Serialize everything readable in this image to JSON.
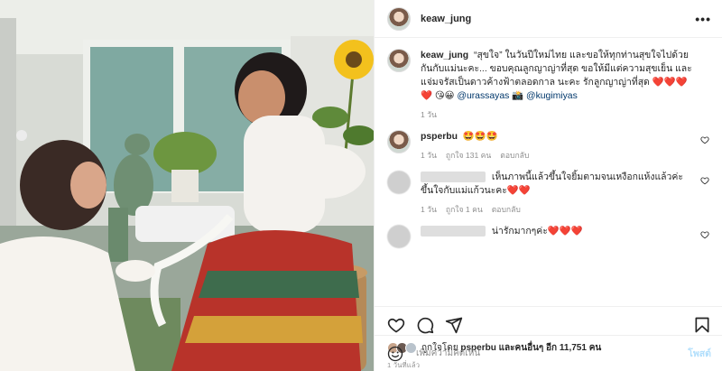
{
  "post": {
    "username": "keaw_jung",
    "more_label": "•••"
  },
  "caption": {
    "username": "keaw_jung",
    "text": "“สุขใจ” ในวันปีใหม่ไทย และขอให้ทุกท่านสุขใจไปด้วยกันกับแม่นะคะ... ขอบคุณลูกญาญ่าที่สุด ขอให้มีแต่ความสุขเย็น และแจ่มจรัสเป็นดาวค้างฟ้าตลอดกาล นะคะ รักลูกญาญ่าที่สุด ❤️❤️❤️❤️ 😘😀",
    "mention1": "@urassayas",
    "camera": "📸",
    "mention2": "@kugimiyas",
    "time": "1 วัน"
  },
  "comments": [
    {
      "username": "psperbu",
      "text": "🤩🤩🤩",
      "time": "1 วัน",
      "likes": "ถูกใจ 131 คน",
      "reply": "ตอบกลับ"
    },
    {
      "username": "",
      "text": "เห็นภาพนี้แล้วขึ้นใจยิ้มตามจนเหงือกแห้งแล้วค่ะขึ้นใจกับแม่แก้วนะคะ❤️❤️",
      "time": "1 วัน",
      "likes": "ถูกใจ 1 คน",
      "reply": "ตอบกลับ"
    },
    {
      "username": "",
      "text": "น่ารักมากๆค่ะ❤️❤️❤️",
      "time": "",
      "likes": "",
      "reply": ""
    }
  ],
  "liked_by": {
    "prefix": "ถูกใจโดย",
    "user": "psperbu",
    "suffix": "และคนอื่นๆ อีก 11,751 คน"
  },
  "posted_ago": "1 วันที่แล้ว",
  "add_comment": {
    "placeholder": "เพิ่มความคิดเห็น",
    "post_label": "โพสต์"
  },
  "icons": [
    "heart-icon",
    "comment-icon",
    "share-icon",
    "save-icon",
    "emoji-icon",
    "more-icon"
  ],
  "colors": {
    "like_red": "#ed4956",
    "link_blue": "#00376b",
    "post_button_disabled": "#b2dffc",
    "meta_gray": "#8e8e8e"
  }
}
